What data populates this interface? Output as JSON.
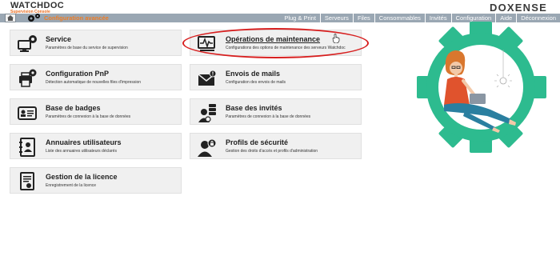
{
  "header": {
    "logo_text": "WATCHDOC",
    "logo_subtitle": "Supervision Console",
    "brand": "DOXENSE"
  },
  "navbar": {
    "page_title": "Configuration avancée",
    "links": [
      "Plug & Print",
      "Serveurs",
      "Files",
      "Consommables",
      "Invités",
      "Configuration",
      "Aide",
      "Déconnexion"
    ]
  },
  "cards": [
    {
      "title": "Service",
      "desc": "Paramètres de base du service de supervision",
      "icon": "gear-monitor-icon"
    },
    {
      "title": "Opérations de maintenance",
      "desc": "Configurations des options de maintenance des serveurs Watchdoc",
      "icon": "monitor-pulse-icon"
    },
    {
      "title": "Configuration PnP",
      "desc": "Détection automatique de nouvelles files d'impression",
      "icon": "printer-gear-icon"
    },
    {
      "title": "Envois de mails",
      "desc": "Configuration des envois de mails",
      "icon": "mail-icon"
    },
    {
      "title": "Base de badges",
      "desc": "Paramètres de connexion à la base de données",
      "icon": "badge-icon"
    },
    {
      "title": "Base des invités",
      "desc": "Paramètres de connexion à la base de données",
      "icon": "guest-database-icon"
    },
    {
      "title": "Annuaires utilisateurs",
      "desc": "Liste des annuaires utilisateurs déclarés",
      "icon": "address-book-icon"
    },
    {
      "title": "Profils de sécurité",
      "desc": "Gestion des droits d'accès et profils d'administration",
      "icon": "security-profile-icon"
    },
    {
      "title": "Gestion de la licence",
      "desc": "Enregistrement de la licence",
      "icon": "license-certificate-icon"
    }
  ],
  "colors": {
    "navbar_bg": "#9aa7b3",
    "accent_orange": "#f07d25",
    "highlight_red": "#d71f1f",
    "illustration_green": "#2dbb8f",
    "card_bg": "#f0f0f0"
  }
}
